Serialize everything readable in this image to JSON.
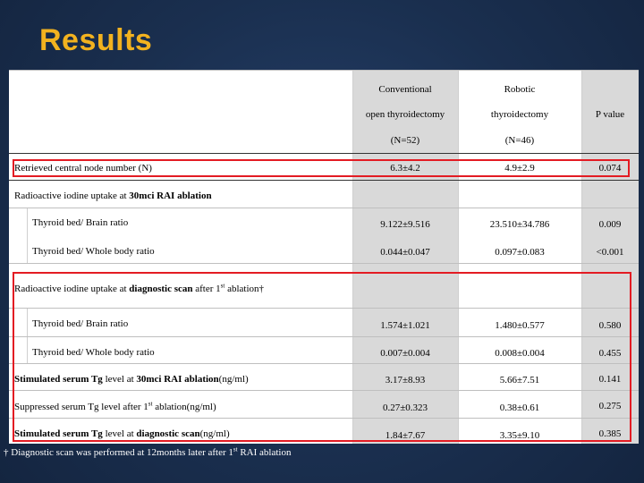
{
  "title": "Results",
  "header": {
    "col1": [
      "Conventional",
      "open thyroidectomy",
      "(N=52)"
    ],
    "col2": [
      "Robotic",
      "thyroidectomy",
      "(N=46)"
    ],
    "col3": "P value"
  },
  "rows": {
    "r1": {
      "label": "Retrieved central node number (N)",
      "v1": "6.3±4.2",
      "v2": "4.9±2.9",
      "p": "0.074"
    },
    "r2": {
      "pre": "Radioactive iodine uptake at ",
      "bold": "30mci RAI ablation"
    },
    "r3": {
      "label": "Thyroid bed/ Brain ratio",
      "v1": "9.122±9.516",
      "v2": "23.510±34.786",
      "p": "0.009"
    },
    "r4": {
      "label": "Thyroid bed/ Whole body ratio",
      "v1": "0.044±0.047",
      "v2": "0.097±0.083",
      "p": "<0.001"
    },
    "r5": {
      "pre": "Radioactive iodine uptake at ",
      "bold": "diagnostic scan",
      "mid": " after 1",
      "sup": "st",
      "post": " ablation†"
    },
    "r6": {
      "label": "Thyroid bed/ Brain ratio",
      "v1": "1.574±1.021",
      "v2": "1.480±0.577",
      "p": "0.580"
    },
    "r7": {
      "label": "Thyroid bed/ Whole body ratio",
      "v1": "0.007±0.004",
      "v2": "0.008±0.004",
      "p": "0.455"
    },
    "r8": {
      "bold1": "Stimulated serum Tg",
      "mid": " level at ",
      "bold2": "30mci RAI ablation",
      "post": "(ng/ml)",
      "v1": "3.17±8.93",
      "v2": "5.66±7.51",
      "p": "0.141"
    },
    "r9": {
      "pre": "Suppressed serum Tg level after 1",
      "sup": "st",
      "post": " ablation(ng/ml)",
      "v1": "0.27±0.323",
      "v2": "0.38±0.61",
      "p": "0.275"
    },
    "r10": {
      "bold1": "Stimulated serum Tg",
      "mid": " level at ",
      "bold2": "diagnostic scan",
      "post": "(ng/ml)",
      "v1": "1.84±7.67",
      "v2": "3.35±9.10",
      "p": "0.385"
    }
  },
  "footnote": {
    "pre": "† Diagnostic scan was performed at 12months later after 1",
    "sup": "st",
    "post": " RAI ablation"
  },
  "colors": {
    "title": "#f2b21f",
    "highlight": "#e31b23",
    "background": "#1a2f4f"
  }
}
